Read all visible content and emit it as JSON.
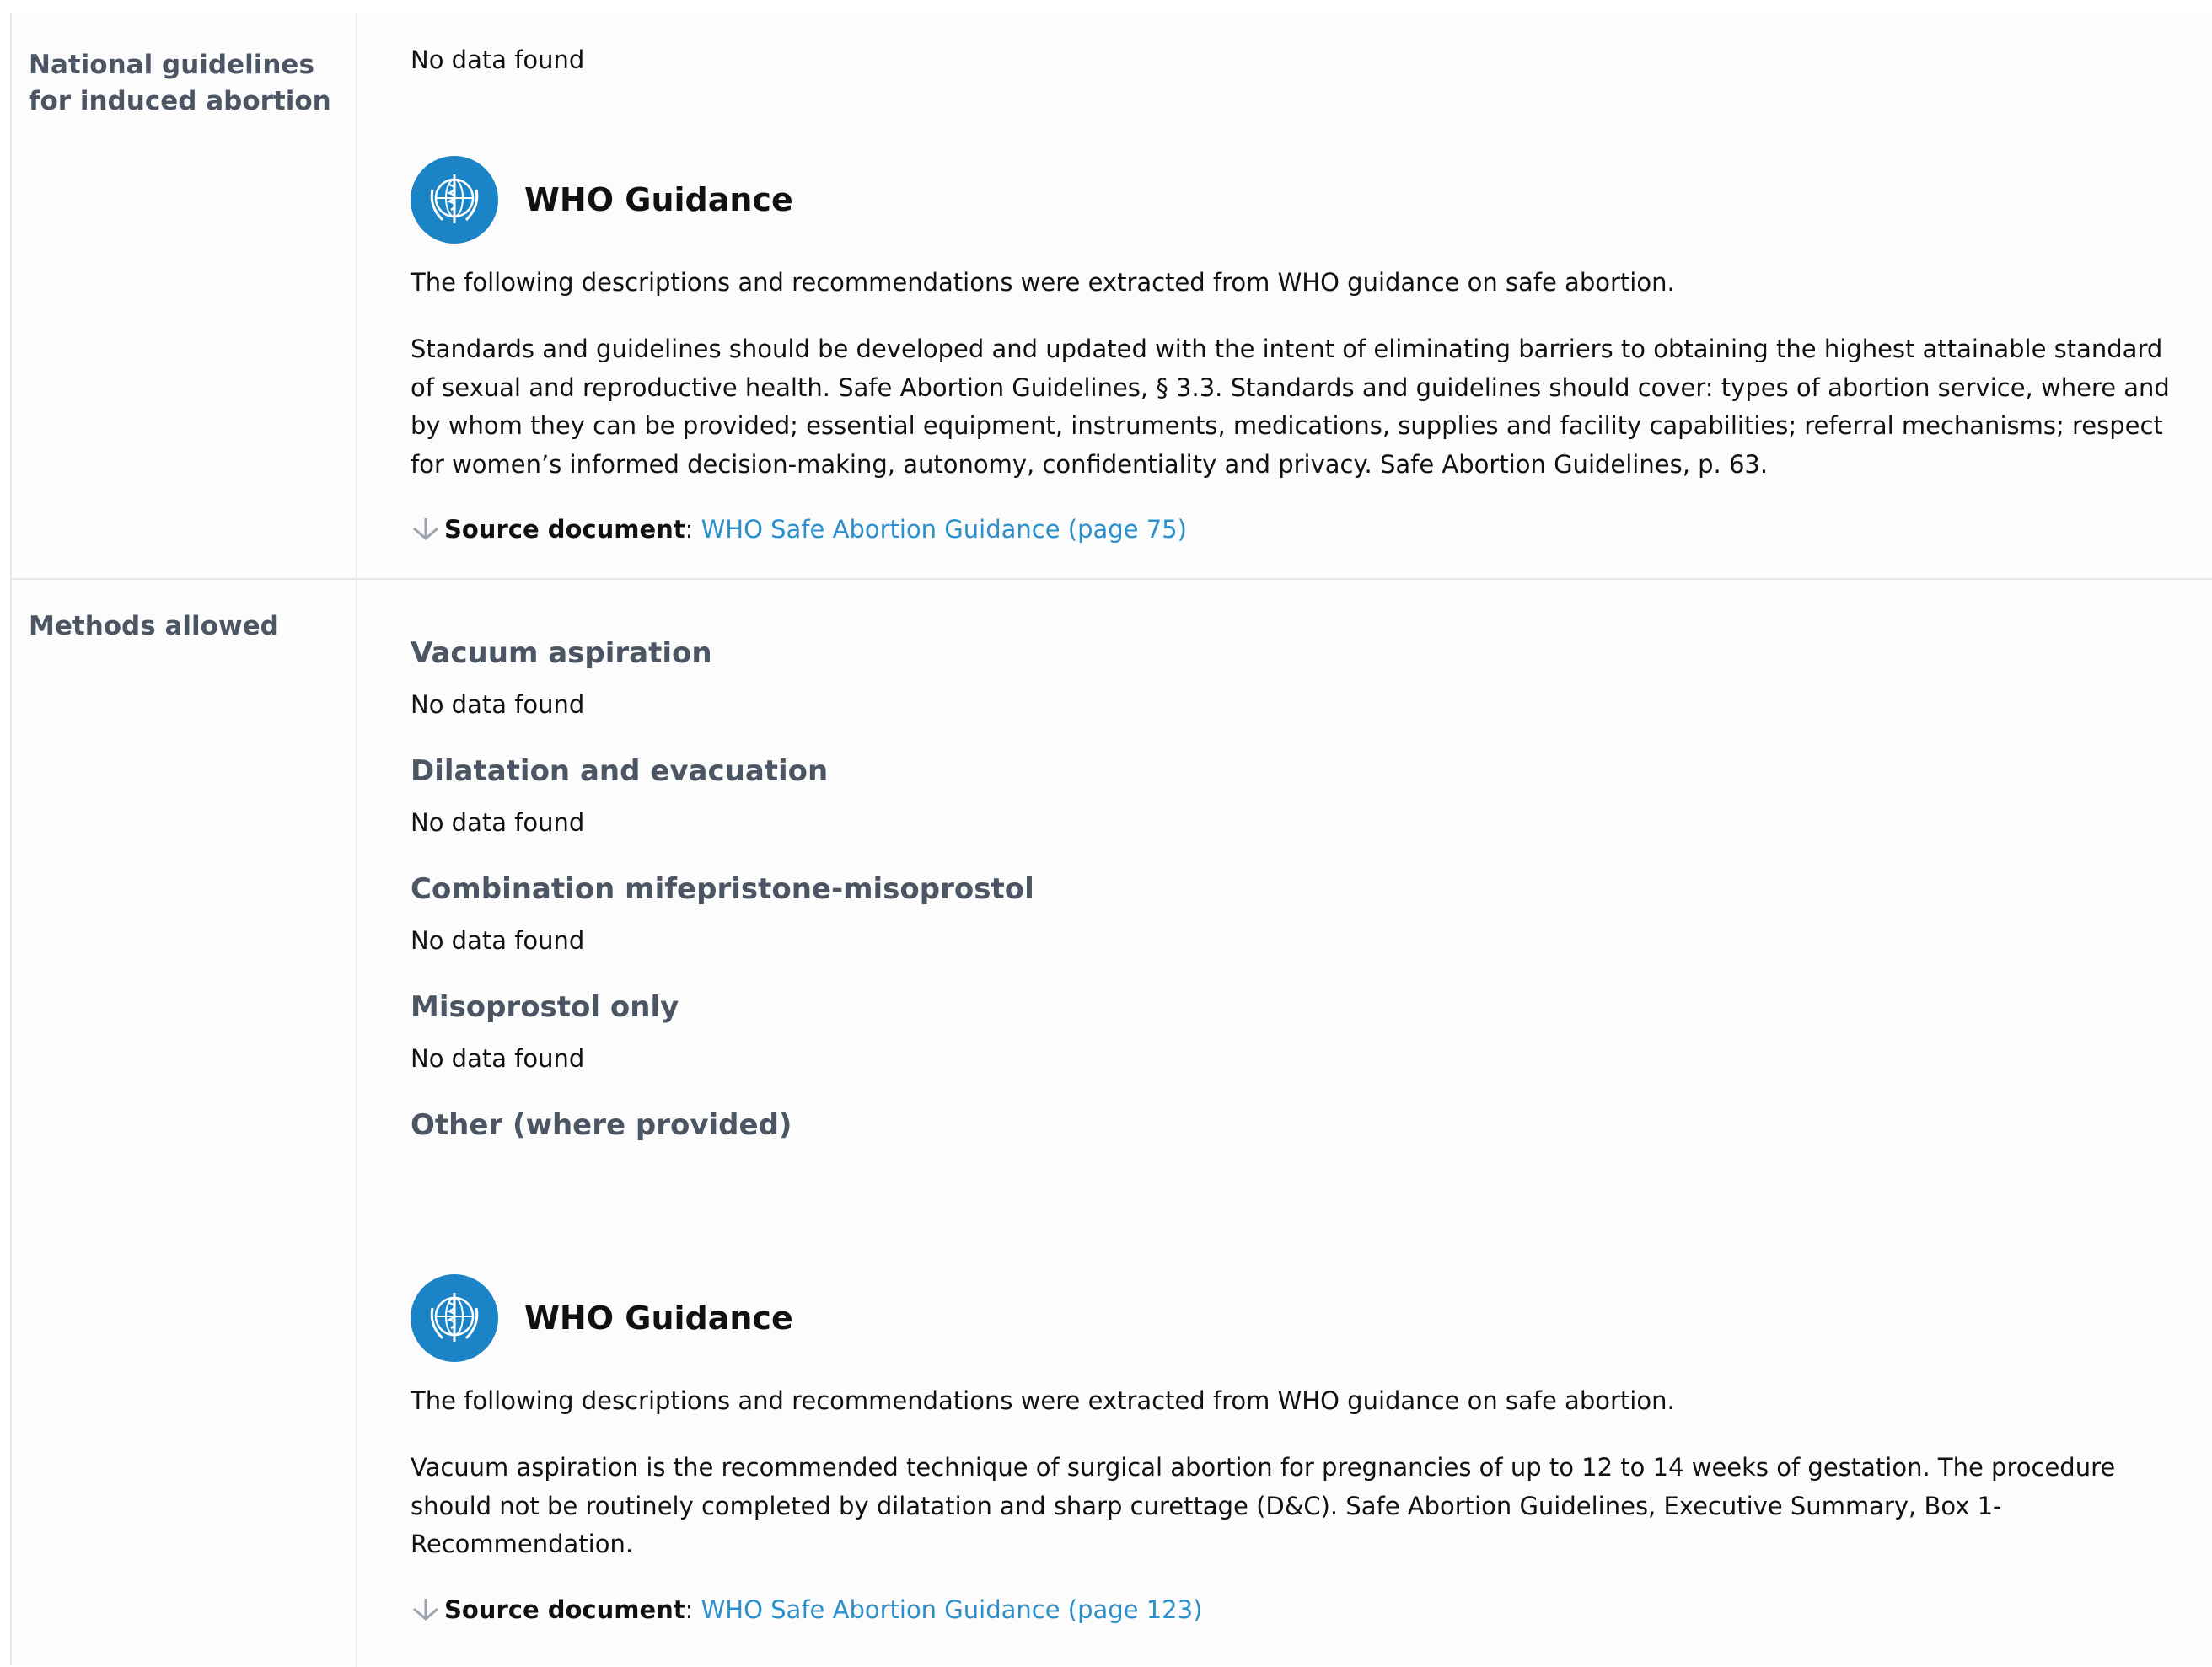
{
  "rows": [
    {
      "label": "National guidelines for induced abortion",
      "national_data": "No data found",
      "who": {
        "title": "WHO Guidance",
        "intro": "The following descriptions and recommendations were extracted from WHO guidance on safe abortion.",
        "body": "Standards and guidelines should be developed and updated with the intent of eliminating barriers to obtaining the highest attainable standard of sexual and reproductive health. Safe Abortion Guidelines, § 3.3. Standards and guidelines should cover: types of abortion service, where and by whom they can be provided; essential equipment, instruments, medications, supplies and facility capabilities; referral mechanisms; respect for women’s informed decision-making, autonomy, confidentiality and privacy. Safe Abortion Guidelines, p. 63.",
        "source_label": "Source document",
        "source_sep": ":",
        "source_link": "WHO Safe Abortion Guidance (page 75)"
      }
    },
    {
      "label": "Methods allowed",
      "methods": [
        {
          "name": "Vacuum aspiration",
          "value": "No data found"
        },
        {
          "name": "Dilatation and evacuation",
          "value": "No data found"
        },
        {
          "name": "Combination mifepristone-misoprostol",
          "value": "No data found"
        },
        {
          "name": "Misoprostol only",
          "value": "No data found"
        },
        {
          "name": "Other (where provided)",
          "value": ""
        }
      ],
      "who": {
        "title": "WHO Guidance",
        "intro": "The following descriptions and recommendations were extracted from WHO guidance on safe abortion.",
        "body": "Vacuum aspiration is the recommended technique of surgical abortion for pregnancies of up to 12 to 14 weeks of gestation. The procedure should not be routinely completed by dilatation and sharp curettage (D&C). Safe Abortion Guidelines, Executive Summary, Box 1- Recommendation.",
        "source_label": "Source document",
        "source_sep": ":",
        "source_link": "WHO Safe Abortion Guidance (page 123)"
      }
    }
  ],
  "icons": {
    "who_logo": "who-emblem-icon",
    "download": "download-arrow-icon"
  },
  "colors": {
    "who_blue": "#1a84c7",
    "link": "#2b8fcb",
    "label_gray": "#4b5563",
    "divider": "#e5e7eb"
  }
}
